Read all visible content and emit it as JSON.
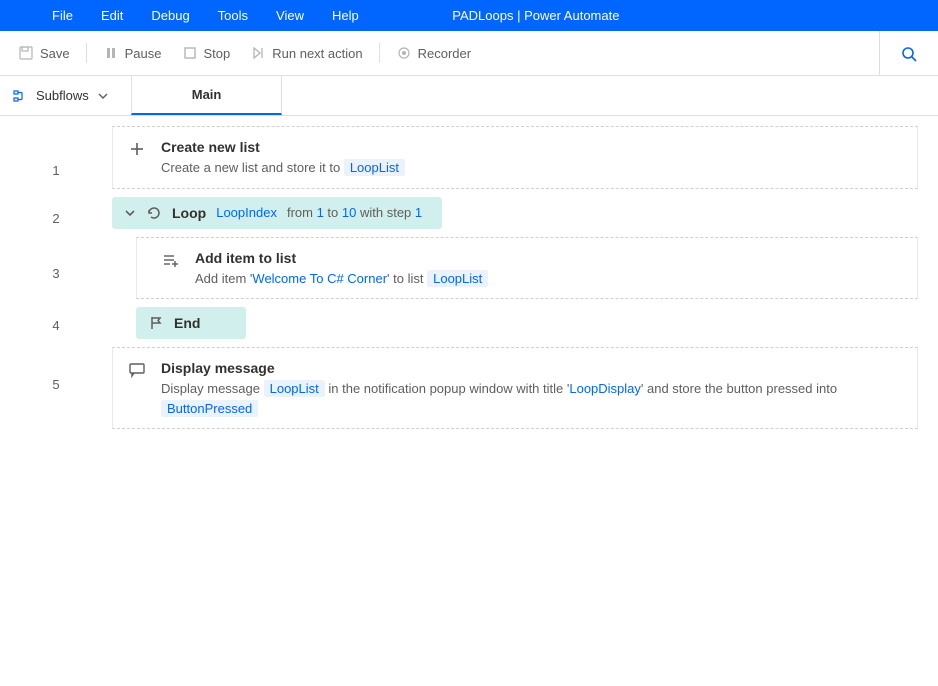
{
  "window_title": "PADLoops | Power Automate",
  "menu": {
    "file": "File",
    "edit": "Edit",
    "debug": "Debug",
    "tools": "Tools",
    "view": "View",
    "help": "Help"
  },
  "toolbar": {
    "save": "Save",
    "pause": "Pause",
    "stop": "Stop",
    "run_next": "Run next action",
    "recorder": "Recorder"
  },
  "subflows_label": "Subflows",
  "main_tab": "Main",
  "lines": {
    "l1": "1",
    "l2": "2",
    "l3": "3",
    "l4": "4",
    "l5": "5"
  },
  "a1": {
    "title": "Create new list",
    "desc_pre": "Create a new list and store it to ",
    "var": "LoopList"
  },
  "a2": {
    "title": "Loop",
    "var": "LoopIndex",
    "from_word": "from ",
    "from": "1",
    "to_word": " to ",
    "to": "10",
    "step_word": " with step ",
    "step": "1"
  },
  "a3": {
    "title": "Add item to list",
    "pre": "Add item '",
    "item": "Welcome To C# Corner",
    "mid": "' to list ",
    "var": "LoopList"
  },
  "a4": {
    "title": "End"
  },
  "a5": {
    "title": "Display message",
    "pre": "Display message ",
    "var1": "LoopList",
    "mid1": " in the notification popup window with title '",
    "titlestr": "LoopDisplay",
    "mid2": "' and store the button pressed into ",
    "var2": "ButtonPressed"
  }
}
